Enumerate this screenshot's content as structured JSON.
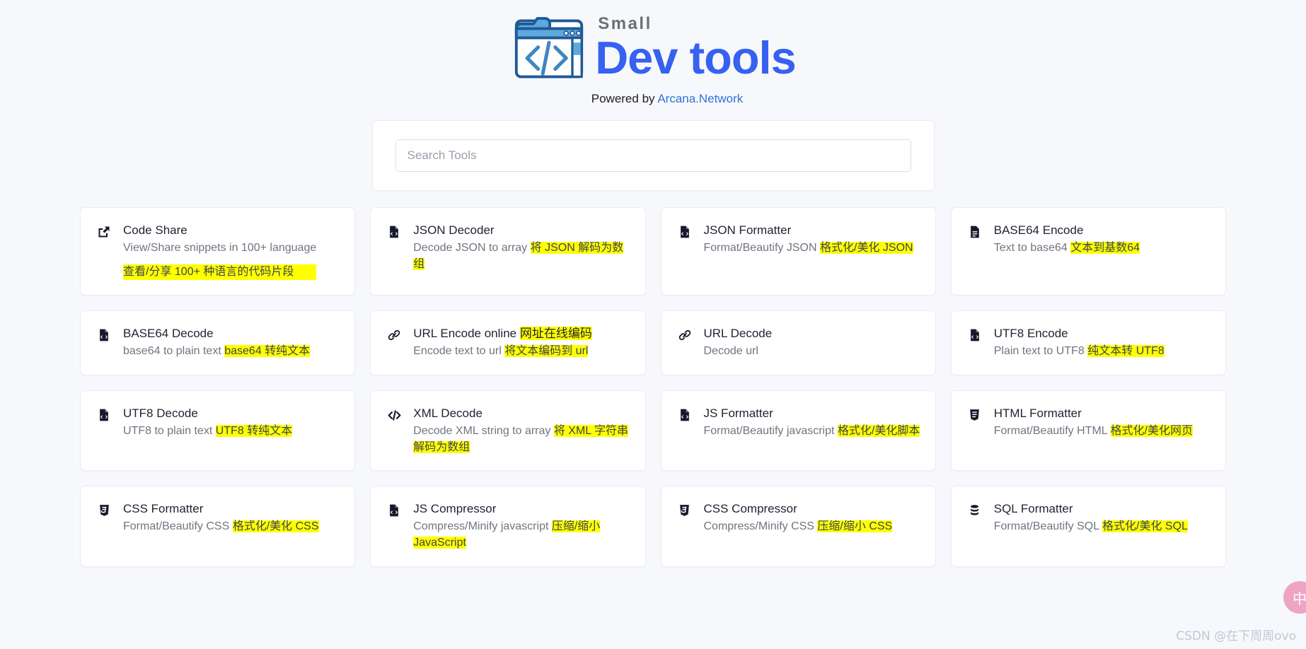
{
  "header": {
    "logo_icon": "code-folder-window-icon",
    "brand_small": "Small",
    "brand_main": "Dev tools",
    "powered_prefix": "Powered by ",
    "powered_link": "Arcana.Network"
  },
  "search": {
    "placeholder": "Search Tools",
    "value": ""
  },
  "colors": {
    "page_bg": "#f7f8fc",
    "card_bg": "#ffffff",
    "card_border": "#ececf1",
    "brand_blue": "#3761f0",
    "link_blue": "#2f73d8",
    "highlight_yellow": "#ffff00",
    "fab_pink": "#eda5c3",
    "muted_text": "#6f7580"
  },
  "tools": [
    {
      "icon": "share-square-icon",
      "title": "Code Share",
      "title_hl": "",
      "desc": "View/Share snippets in 100+ language",
      "desc_hl": "",
      "desc_block_hl": "查看/分享 100+ 种语言的代码片段"
    },
    {
      "icon": "file-code-icon",
      "title": "JSON Decoder",
      "title_hl": "",
      "desc": "Decode JSON to array ",
      "desc_hl": "将 JSON 解码为数组",
      "desc_block_hl": ""
    },
    {
      "icon": "file-code-icon",
      "title": "JSON Formatter",
      "title_hl": "",
      "desc": "Format/Beautify JSON ",
      "desc_hl": "格式化/美化 JSON",
      "desc_block_hl": ""
    },
    {
      "icon": "file-lines-icon",
      "title": "BASE64 Encode",
      "title_hl": "",
      "desc": "Text to base64 ",
      "desc_hl": "文本到基数64",
      "desc_block_hl": ""
    },
    {
      "icon": "file-code-icon",
      "title": "BASE64 Decode",
      "title_hl": "",
      "desc": "base64 to plain text ",
      "desc_hl": "base64 转纯文本",
      "desc_block_hl": ""
    },
    {
      "icon": "link-icon",
      "title": "URL Encode online ",
      "title_hl": "网址在线编码",
      "desc": "Encode text to url ",
      "desc_hl": "将文本编码到 url",
      "desc_block_hl": ""
    },
    {
      "icon": "link-icon",
      "title": "URL Decode",
      "title_hl": "",
      "desc": "Decode url",
      "desc_hl": "",
      "desc_block_hl": ""
    },
    {
      "icon": "file-code-icon",
      "title": "UTF8 Encode",
      "title_hl": "",
      "desc": "Plain text to UTF8 ",
      "desc_hl": "纯文本转 UTF8",
      "desc_block_hl": ""
    },
    {
      "icon": "file-code-icon",
      "title": "UTF8 Decode",
      "title_hl": "",
      "desc": "UTF8 to plain text ",
      "desc_hl": "UTF8 转纯文本",
      "desc_block_hl": ""
    },
    {
      "icon": "code-brackets-icon",
      "title": "XML Decode",
      "title_hl": "",
      "desc": "Decode XML string to array ",
      "desc_hl": "将 XML 字符串解码为数组",
      "desc_block_hl": ""
    },
    {
      "icon": "file-code-icon",
      "title": "JS Formatter",
      "title_hl": "",
      "desc": "Format/Beautify javascript ",
      "desc_hl": "格式化/美化脚本",
      "desc_block_hl": ""
    },
    {
      "icon": "html5-shield-icon",
      "title": "HTML Formatter",
      "title_hl": "",
      "desc": "Format/Beautify HTML ",
      "desc_hl": "格式化/美化网页",
      "desc_block_hl": ""
    },
    {
      "icon": "css3-shield-icon",
      "title": "CSS Formatter",
      "title_hl": "",
      "desc": "Format/Beautify CSS ",
      "desc_hl": "格式化/美化 CSS",
      "desc_block_hl": ""
    },
    {
      "icon": "file-code-icon",
      "title": "JS Compressor",
      "title_hl": "",
      "desc": "Compress/Minify javascript ",
      "desc_hl": "压缩/缩小 JavaScript",
      "desc_block_hl": ""
    },
    {
      "icon": "css3-shield-icon",
      "title": "CSS Compressor",
      "title_hl": "",
      "desc": "Compress/Minify CSS ",
      "desc_hl": "压缩/缩小 CSS",
      "desc_block_hl": ""
    },
    {
      "icon": "database-icon",
      "title": "SQL Formatter",
      "title_hl": "",
      "desc": "Format/Beautify SQL ",
      "desc_hl": "格式化/美化 SQL",
      "desc_block_hl": ""
    }
  ],
  "floating_button": {
    "icon": "translate-chinese-icon",
    "label": "中"
  },
  "watermark": "CSDN @在下周周ovo"
}
